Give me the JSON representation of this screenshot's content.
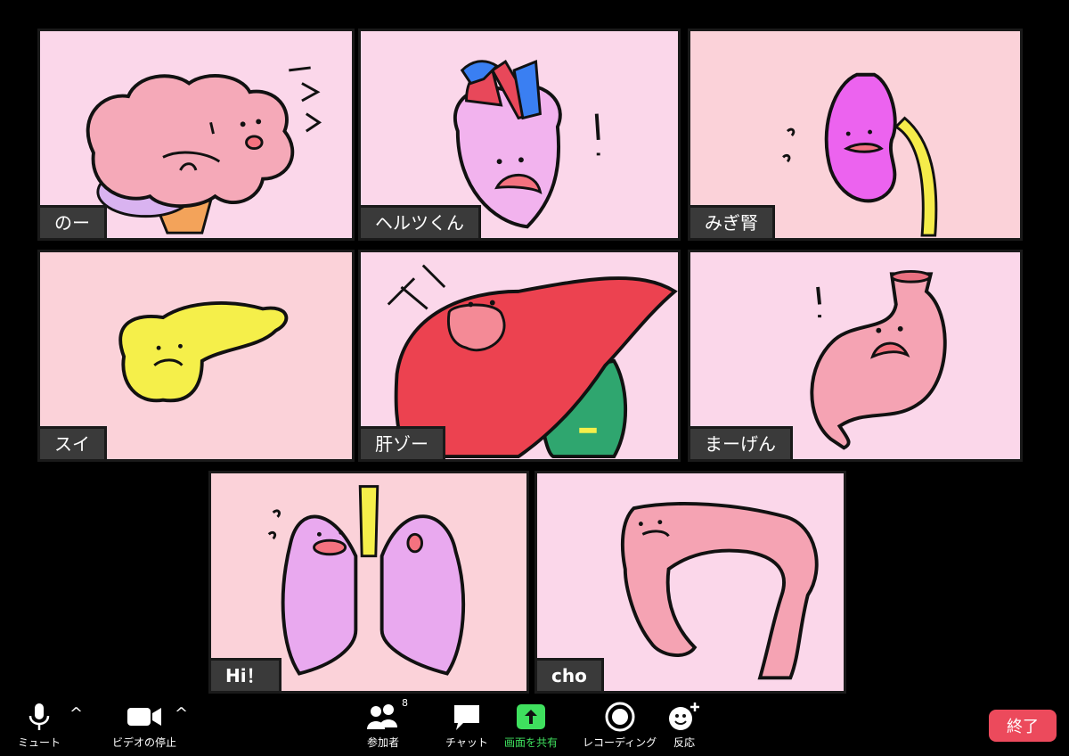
{
  "participants": [
    {
      "name": "のー",
      "bg": "#fbd7ea",
      "organ": "brain"
    },
    {
      "name": "ヘルツくん",
      "bg": "#fbd7ea",
      "organ": "heart"
    },
    {
      "name": "みぎ腎",
      "bg": "#fbd2d9",
      "organ": "kidney"
    },
    {
      "name": "スイ",
      "bg": "#fbd2d9",
      "organ": "pancreas"
    },
    {
      "name": "肝ゾー",
      "bg": "#fbd7ea",
      "organ": "liver"
    },
    {
      "name": "まーげん",
      "bg": "#fbd7ea",
      "organ": "stomach"
    },
    {
      "name": "Hi！",
      "bg": "#fbd2d9",
      "organ": "lungs"
    },
    {
      "name": "cho",
      "bg": "#fbd7ea",
      "organ": "intestine"
    }
  ],
  "toolbar": {
    "mute": {
      "label": "ミュート",
      "icon": "microphone-icon"
    },
    "video": {
      "label": "ビデオの停止",
      "icon": "video-camera-icon"
    },
    "participants": {
      "label": "参加者",
      "count": "8",
      "icon": "participants-icon"
    },
    "chat": {
      "label": "チャット",
      "icon": "chat-icon"
    },
    "share": {
      "label": "画面を共有",
      "icon": "share-screen-icon",
      "color": "#3fe05e"
    },
    "record": {
      "label": "レコーディング",
      "icon": "record-icon"
    },
    "reactions": {
      "label": "反応",
      "icon": "reaction-icon"
    },
    "end": {
      "label": "終了",
      "color": "#ec4a5c"
    }
  }
}
